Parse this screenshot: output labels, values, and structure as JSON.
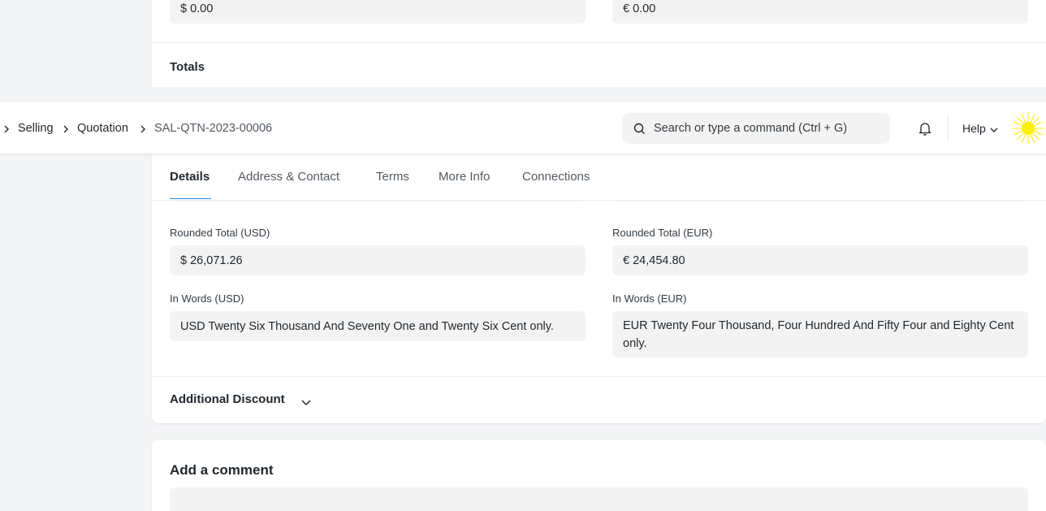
{
  "top_card": {
    "usd_value": "$ 0.00",
    "eur_value": "€ 0.00",
    "section_title": "Totals"
  },
  "navbar": {
    "breadcrumbs": [
      "Selling",
      "Quotation",
      "SAL-QTN-2023-00006"
    ],
    "search_placeholder": "Search or type a command (Ctrl + G)",
    "help_label": "Help"
  },
  "tabs": [
    "Details",
    "Address & Contact",
    "Terms",
    "More Info",
    "Connections"
  ],
  "fields": {
    "rounded_total_usd": {
      "label": "Rounded Total (USD)",
      "value": "$ 26,071.26"
    },
    "rounded_total_eur": {
      "label": "Rounded Total (EUR)",
      "value": "€ 24,454.80"
    },
    "in_words_usd": {
      "label": "In Words (USD)",
      "value": "USD Twenty Six Thousand And Seventy One and Twenty Six Cent only."
    },
    "in_words_eur": {
      "label": "In Words (EUR)",
      "value": "EUR Twenty Four Thousand, Four Hundred And Fifty Four and Eighty Cent only."
    }
  },
  "additional_discount": {
    "title": "Additional Discount"
  },
  "comment": {
    "title": "Add a comment"
  },
  "colors": {
    "accent": "#2490ef",
    "field_bg": "#f3f3f3",
    "avatar": "#ffef00"
  },
  "icons": [
    "chevron-right-icon",
    "search-icon",
    "bell-icon",
    "chevron-down-icon",
    "avatar-sun-icon"
  ]
}
